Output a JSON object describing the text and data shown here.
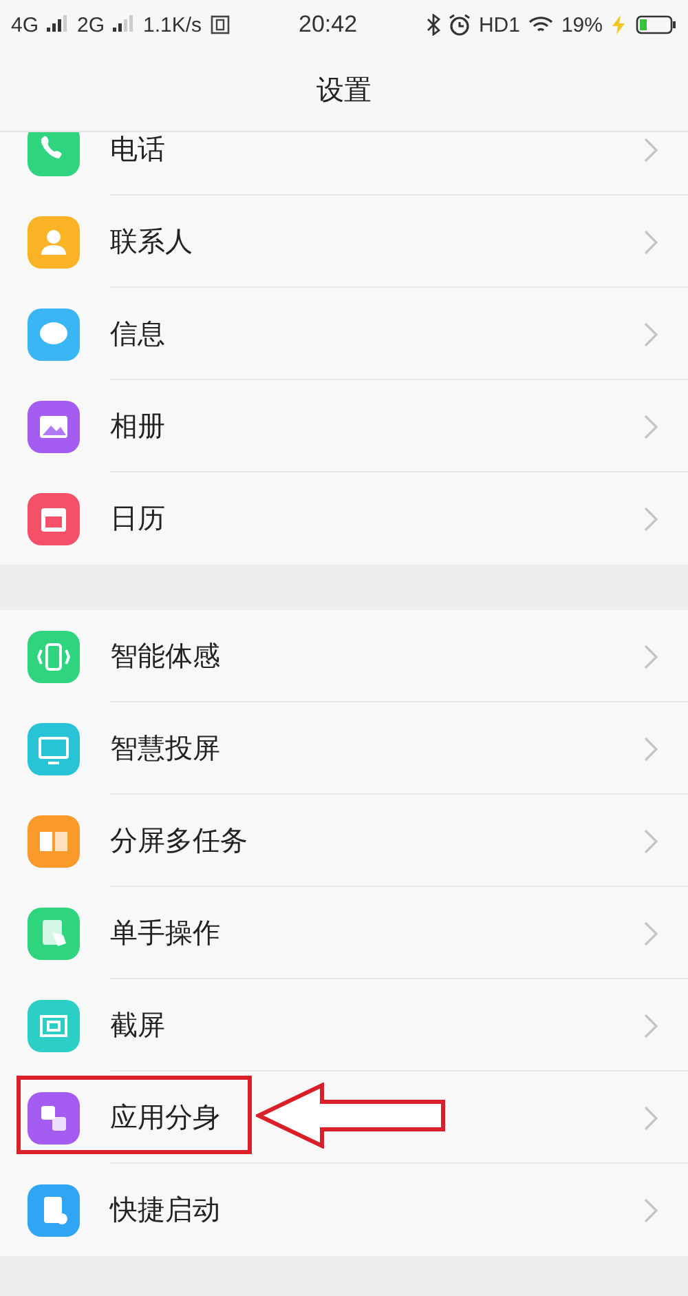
{
  "status_bar": {
    "network_1": "4G",
    "network_2": "2G",
    "speed": "1.1K/s",
    "time": "20:42",
    "hd": "HD1",
    "battery": "19%"
  },
  "header": {
    "title": "设置"
  },
  "sections": [
    {
      "items": [
        {
          "label": "电话",
          "color": "#2fd47f",
          "highlighted": false
        },
        {
          "label": "联系人",
          "color": "#f9b324",
          "highlighted": false
        },
        {
          "label": "信息",
          "color": "#3ab6f5",
          "highlighted": false
        },
        {
          "label": "相册",
          "color": "#a45cf0",
          "highlighted": false
        },
        {
          "label": "日历",
          "color": "#f4506a",
          "highlighted": false
        }
      ]
    },
    {
      "items": [
        {
          "label": "智能体感",
          "color": "#2fd47f",
          "highlighted": false
        },
        {
          "label": "智慧投屏",
          "color": "#28c3d6",
          "highlighted": false
        },
        {
          "label": "分屏多任务",
          "color": "#f99a2a",
          "highlighted": false
        },
        {
          "label": "单手操作",
          "color": "#2fd47f",
          "highlighted": false
        },
        {
          "label": "截屏",
          "color": "#2bcfc6",
          "highlighted": false
        },
        {
          "label": "应用分身",
          "color": "#a45cf0",
          "highlighted": true
        },
        {
          "label": "快捷启动",
          "color": "#2fa5f3",
          "highlighted": false
        }
      ]
    }
  ]
}
